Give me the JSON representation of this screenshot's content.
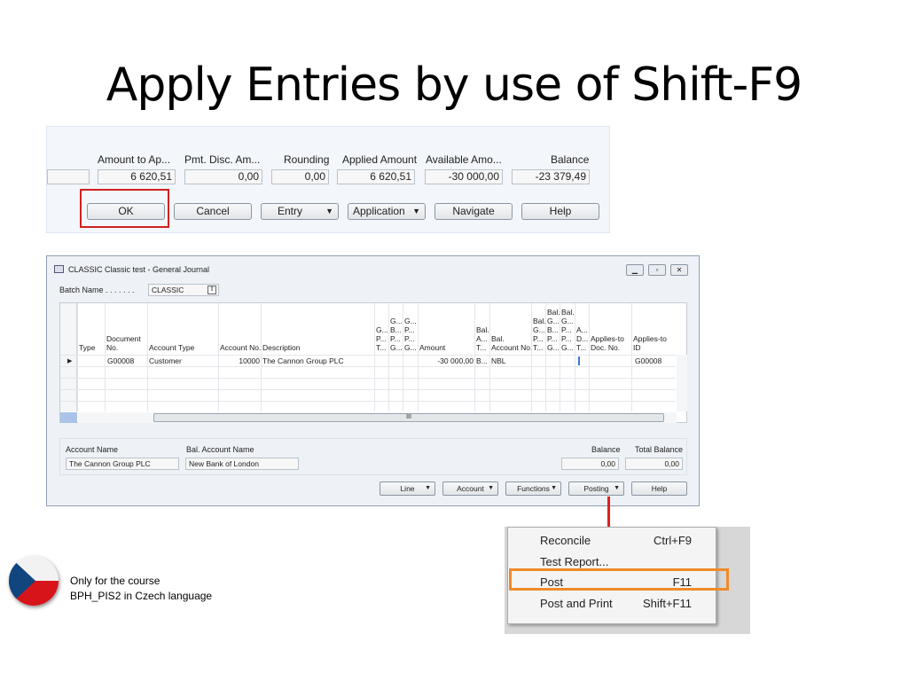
{
  "title": "Apply Entries by use of Shift-F9",
  "apply_dialog": {
    "fields": [
      {
        "label": "Amount to Ap...",
        "value": "6 620,51"
      },
      {
        "label": "Pmt. Disc. Am...",
        "value": "0,00"
      },
      {
        "label": "Rounding",
        "value": "0,00"
      },
      {
        "label": "Applied Amount",
        "value": "6 620,51"
      },
      {
        "label": "Available Amo...",
        "value": "-30 000,00"
      },
      {
        "label": "Balance",
        "value": "-23 379,49"
      }
    ],
    "buttons": {
      "ok": "OK",
      "cancel": "Cancel",
      "entry": "Entry",
      "application": "Application",
      "navigate": "Navigate",
      "help": "Help"
    },
    "highlight_color": "#d02020"
  },
  "journal": {
    "window_title": "CLASSIC Classic test - General Journal",
    "batch_label": "Batch Name . . . . . . .",
    "batch_value": "CLASSIC",
    "headers": [
      "Type",
      "Document\nNo.",
      "Account Type",
      "Account No.",
      "Description",
      "G...\nP...\nT...",
      "G...\nB...\nP...\nG...",
      "G...\nP...\nP...\nG...",
      "Amount",
      "Bal.\nA...\nT...",
      "Bal.\nAccount No.",
      "Bal.\nG...\nP...\nT...",
      "Bal.\nG...\nB...\nP...\nG...",
      "Bal.\nG...\nP...\nP...\nG...",
      "A...\nD...\nT...",
      "Applies-to\nDoc. No.",
      "Applies-to\nID"
    ],
    "row": {
      "document_no": "G00008",
      "account_type": "Customer",
      "account_no": "10000",
      "description": "The Cannon Group PLC",
      "amount": "-30 000,00",
      "bal_account_type": "B...",
      "bal_account_no": "NBL",
      "applies_to_id": "G00008"
    },
    "scroll_grip": "III",
    "account_name_label": "Account Name",
    "account_name": "The Cannon Group PLC",
    "bal_account_name_label": "Bal. Account Name",
    "bal_account_name": "New Bank of London",
    "balance_label": "Balance",
    "balance": "0,00",
    "total_balance_label": "Total Balance",
    "total_balance": "0,00",
    "buttons": {
      "line": "Line",
      "account": "Account",
      "functions": "Functions",
      "posting": "Posting",
      "help": "Help"
    }
  },
  "posting_menu": {
    "items": [
      {
        "label": "Reconcile",
        "shortcut": "Ctrl+F9"
      },
      {
        "label": "Test Report...",
        "shortcut": ""
      },
      {
        "label": "Post",
        "shortcut": "F11"
      },
      {
        "label": "Post and Print",
        "shortcut": "Shift+F11"
      }
    ],
    "highlight_color": "#f08a2a"
  },
  "note": {
    "line1": "Only for the course",
    "line2": "BPH_PIS2 in Czech language"
  }
}
